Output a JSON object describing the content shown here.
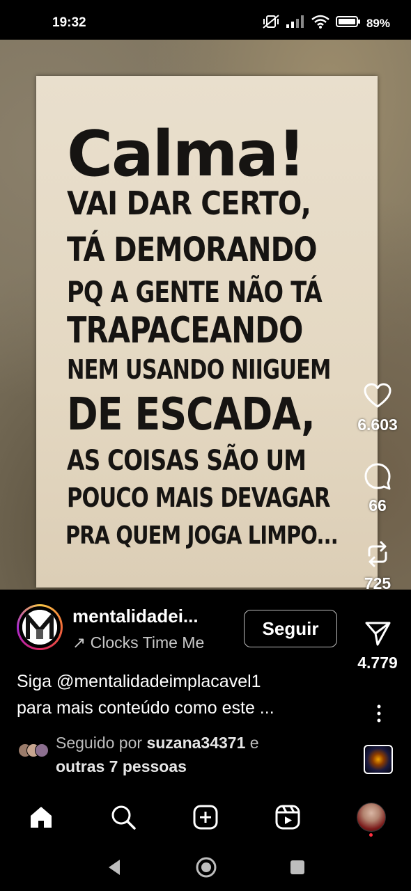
{
  "status_bar": {
    "time": "19:32",
    "battery": "89%",
    "icons": [
      "muted-vibrate-icon",
      "signal-icon",
      "wifi-icon",
      "battery-icon"
    ]
  },
  "poster": {
    "lines": [
      "Calma!",
      "VAI DAR CERTO,",
      "TÁ DEMORANDO",
      "PQ A GENTE NÃO TÁ",
      "TRAPACEANDO",
      "NEM USANDO NIIGUEM",
      "DE ESCADA,",
      "AS COISAS SÃO UM",
      "POUCO MAIS DEVAGAR",
      "PRA QUEM JOGA LIMPO..."
    ]
  },
  "actions": {
    "likes": "6.603",
    "comments": "66",
    "reposts": "725",
    "shares": "4.779"
  },
  "account": {
    "username": "mentalidadei...",
    "audio": "↗ Clocks Time   Me",
    "follow_label": "Seguir"
  },
  "caption": {
    "line1": "Siga @mentalidadeimplacavel1",
    "line2": "para mais conteúdo como este ..."
  },
  "followed_by": {
    "prefix": "Seguido por ",
    "user": "suzana34371",
    "suffix": " e",
    "line2": "outras 7 pessoas"
  },
  "nav": {
    "items": [
      "home-icon",
      "search-icon",
      "create-icon",
      "reels-icon",
      "profile-avatar"
    ]
  },
  "colors": {
    "background": "#000000",
    "poster_paper": "#e6dbc6",
    "poster_ink": "#161412",
    "notification_dot": "#ff3040"
  }
}
